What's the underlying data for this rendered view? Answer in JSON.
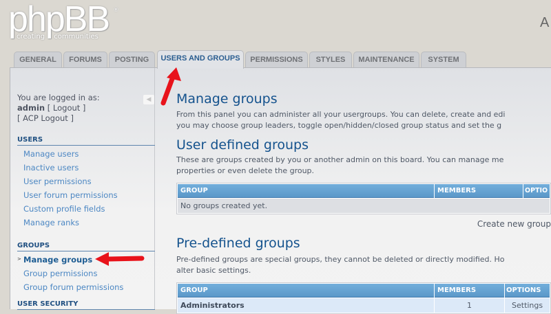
{
  "logo": {
    "main": "phpBB",
    "registered": "®",
    "tagline": "creating communities"
  },
  "header": {
    "title_partial": "A"
  },
  "tabs": [
    {
      "label": "GENERAL"
    },
    {
      "label": "FORUMS"
    },
    {
      "label": "POSTING"
    },
    {
      "label": "USERS AND GROUPS",
      "active": true
    },
    {
      "label": "PERMISSIONS"
    },
    {
      "label": "STYLES"
    },
    {
      "label": "MAINTENANCE"
    },
    {
      "label": "SYSTEM"
    }
  ],
  "sidebar": {
    "logged_in_as": "You are logged in as:",
    "username": "admin",
    "logout": "[ Logout ]",
    "acp_logout": "[ ACP Logout ]",
    "collapse_icon": "triangle-left",
    "sections": [
      {
        "title": "USERS",
        "items": [
          "Manage users",
          "Inactive users",
          "User permissions",
          "User forum permissions",
          "Custom profile fields",
          "Manage ranks"
        ]
      },
      {
        "title": "GROUPS",
        "items": [
          "Manage groups",
          "Group permissions",
          "Group forum permissions"
        ],
        "active": "Manage groups"
      },
      {
        "title": "USER SECURITY",
        "items": []
      }
    ]
  },
  "main": {
    "title": "Manage groups",
    "intro": [
      "From this panel you can administer all your usergroups. You can delete, create and edi",
      "you may choose group leaders, toggle open/hidden/closed group status and set the g"
    ],
    "user_defined": {
      "title": "User defined groups",
      "desc": [
        "These are groups created by you or another admin on this board. You can manage me",
        "properties or even delete the group."
      ],
      "columns": [
        "GROUP",
        "MEMBERS",
        "OPTIO"
      ],
      "empty": "No groups created yet.",
      "create_label": "Create new group"
    },
    "predefined": {
      "title": "Pre-defined groups",
      "desc": [
        "Pre-defined groups are special groups, they cannot be deleted or directly modified. Ho",
        "alter basic settings."
      ],
      "columns": [
        "GROUP",
        "MEMBERS",
        "OPTIONS"
      ],
      "rows": [
        {
          "group": "Administrators",
          "members": "1",
          "options": "Settings"
        }
      ]
    }
  },
  "colors": {
    "accent": "#14528d",
    "table_header": "#5b98c9",
    "annotation_arrow": "#e8131b"
  }
}
